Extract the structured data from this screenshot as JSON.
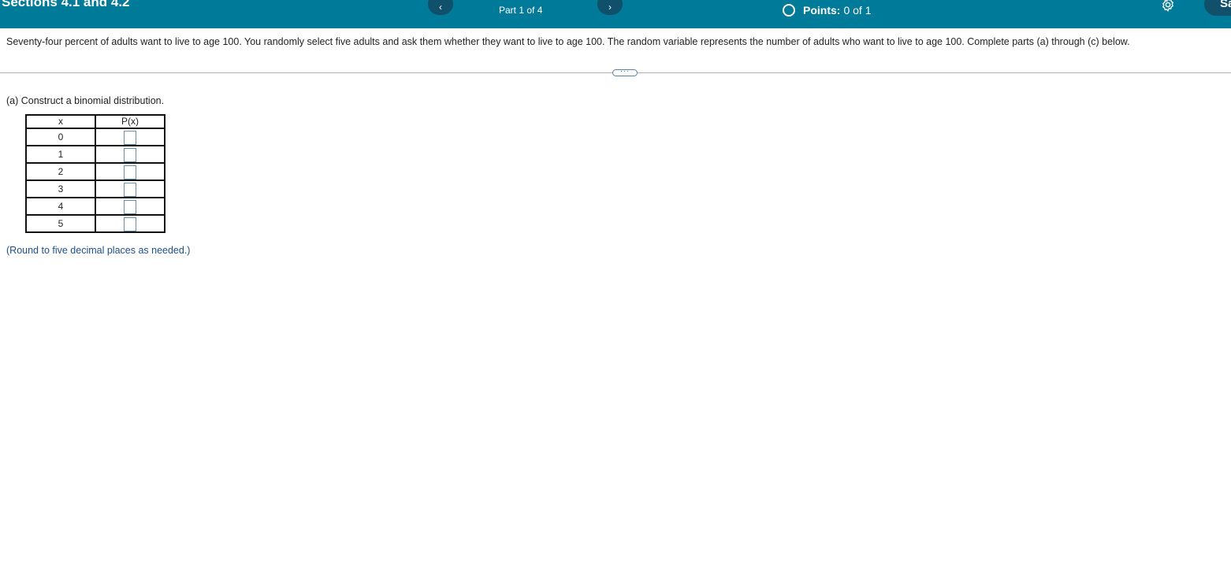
{
  "header": {
    "title": "Sections 4.1 and 4.2",
    "prev_icon": "‹",
    "next_icon": "›",
    "part": "Part 1 of 4",
    "points_label": "Points:",
    "points_value": "0 of 1",
    "save_label": "Sa",
    "bg_color": "#007a99"
  },
  "question": {
    "text": "Seventy-four percent of adults want to live to age 100. You randomly select five adults and ask them whether they want to live to age 100. The random variable represents the number of adults who want to live to age 100. Complete parts (a) through (c) below.",
    "expand_label": "···"
  },
  "part_a": {
    "prompt": "(a) Construct a binomial distribution.",
    "table": {
      "headers": [
        "x",
        "P(x)"
      ],
      "rows": [
        {
          "x": "0",
          "p": ""
        },
        {
          "x": "1",
          "p": ""
        },
        {
          "x": "2",
          "p": ""
        },
        {
          "x": "3",
          "p": ""
        },
        {
          "x": "4",
          "p": ""
        },
        {
          "x": "5",
          "p": ""
        }
      ]
    },
    "instruction": "(Round to five decimal places as needed.)"
  }
}
